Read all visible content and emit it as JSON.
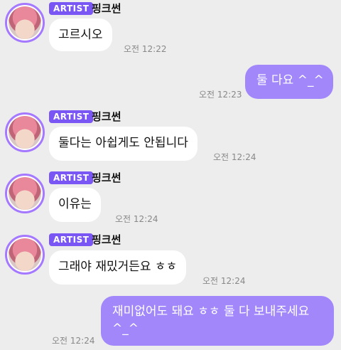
{
  "messages": [
    {
      "badge": "ARTIST",
      "sender": "핑크썬",
      "text": "고르시오",
      "time": "오전 12:22"
    },
    {
      "text": "둘 다요 ^_^",
      "time": "오전 12:23"
    },
    {
      "badge": "ARTIST",
      "sender": "핑크썬",
      "text": "둘다는 아쉽게도 안됩니다",
      "time": "오전 12:24"
    },
    {
      "badge": "ARTIST",
      "sender": "핑크썬",
      "text": "이유는",
      "time": "오전 12:24"
    },
    {
      "badge": "ARTIST",
      "sender": "핑크썬",
      "text": "그래야 재밌거든요 ㅎㅎ",
      "time": "오전 12:24"
    },
    {
      "text": "재미없어도 돼요 ㅎㅎ 둘 다 보내주세요 ^_^",
      "time": "오전 12:24"
    }
  ],
  "colors": {
    "background": "#ededed",
    "outgoing_bubble": "#a287fb",
    "incoming_bubble": "#ffffff",
    "artist_badge": "#7a56f4",
    "avatar_ring": "#a479ff"
  },
  "icons": {
    "avatar": "artist-avatar"
  }
}
